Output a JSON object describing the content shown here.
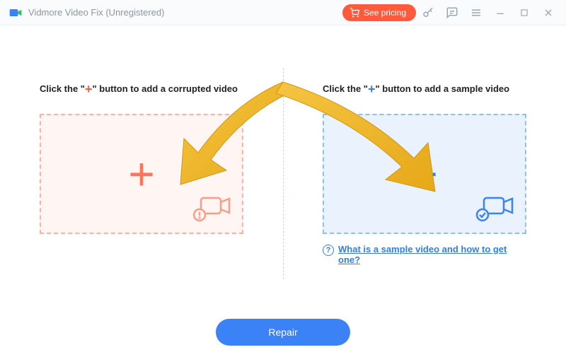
{
  "titlebar": {
    "title": "Vidmore Video Fix (Unregistered)",
    "pricing_label": "See pricing"
  },
  "left": {
    "heading_pre": "Click the \"",
    "heading_post": "\" button to add a corrupted video"
  },
  "right": {
    "heading_pre": "Click the \"",
    "heading_post": "\" button to add a sample video",
    "help_text": "What is a sample video and how to get one?"
  },
  "footer": {
    "repair_label": "Repair"
  }
}
